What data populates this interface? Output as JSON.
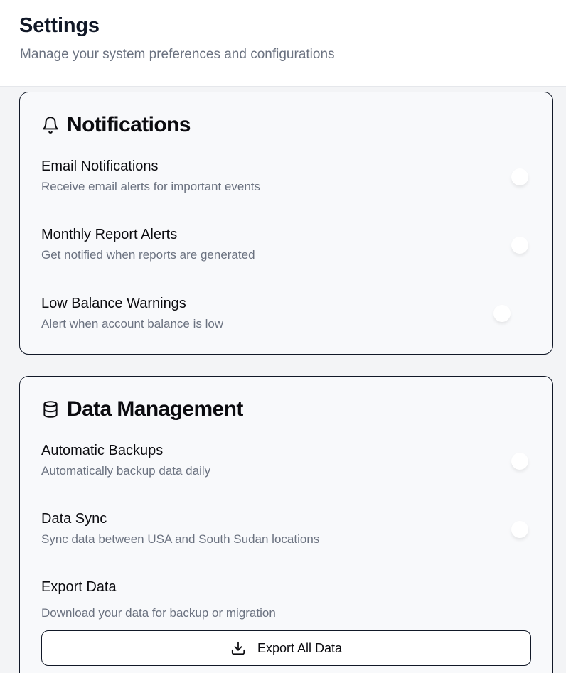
{
  "header": {
    "title": "Settings",
    "subtitle": "Manage your system preferences and configurations"
  },
  "notifications": {
    "title": "Notifications",
    "icon": "bell-icon",
    "items": [
      {
        "label": "Email Notifications",
        "description": "Receive email alerts for important events"
      },
      {
        "label": "Monthly Report Alerts",
        "description": "Get notified when reports are generated"
      },
      {
        "label": "Low Balance Warnings",
        "description": "Alert when account balance is low"
      }
    ]
  },
  "data_management": {
    "title": "Data Management",
    "icon": "database-icon",
    "items": [
      {
        "label": "Automatic Backups",
        "description": "Automatically backup data daily"
      },
      {
        "label": "Data Sync",
        "description": "Sync data between USA and South Sudan locations"
      },
      {
        "label": "Export Data",
        "description": "Download your data for backup or migration"
      }
    ],
    "export_button": {
      "label": "Export All Data",
      "icon": "download-icon"
    }
  },
  "colors": {
    "text_primary": "#0b0b0f",
    "text_muted": "#6b7280",
    "card_border": "#111827",
    "card_background": "#f8f9fb",
    "page_background": "#f3f4f6"
  }
}
